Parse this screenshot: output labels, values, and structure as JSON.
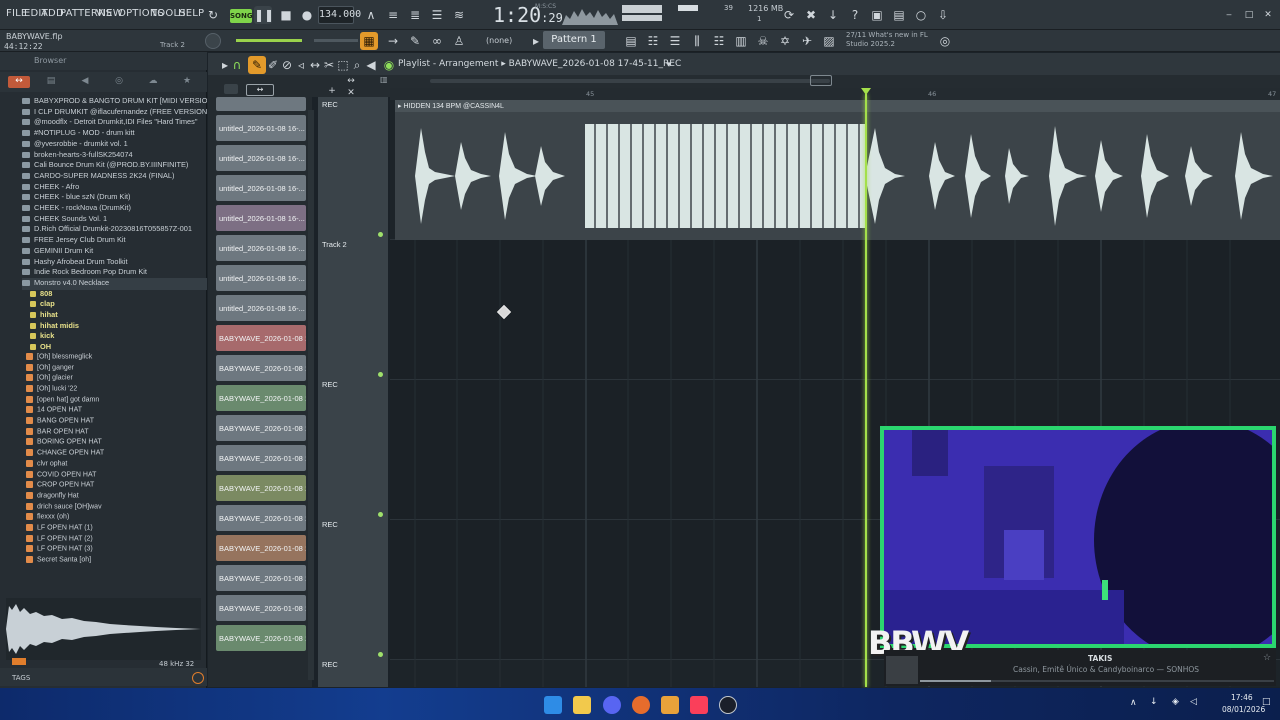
{
  "menu": [
    "FILE",
    "EDIT",
    "ADD",
    "PATTERNS",
    "VIEW",
    "OPTIONS",
    "TOOLS",
    "HELP"
  ],
  "transport": {
    "song_label": "SONG",
    "tempo": "134.000",
    "clock_main": "1:20",
    "clock_sub": ":29",
    "clock_unit": "M:S:CS",
    "cpu_value": "39",
    "cpu_poly": "1",
    "memory": "1216 MB"
  },
  "project": {
    "file": "BABYWAVE.flp",
    "time": "44:12:22",
    "hint_track": "Track 2"
  },
  "toolbar2": {
    "none_label": "(none)",
    "pattern": "Pattern 1",
    "whatsnew_line1": "27/11  What's new in FL",
    "whatsnew_line2": "Studio 2025.2"
  },
  "browser": {
    "header": "Browser",
    "items": [
      {
        "label": "BABYXPROD & BANGTO DRUM KIT [MIDI VERSION]",
        "type": "folder"
      },
      {
        "label": "I CLP DRUMKIT @iflacufernandez (FREE VERSION)",
        "type": "folder"
      },
      {
        "label": "@moodflx - Detroit Drumkit,IDI Files \"Hard Times\"",
        "type": "folder"
      },
      {
        "label": "#NOTIPLUG - MOD - drum kitt",
        "type": "folder"
      },
      {
        "label": "@yvesrobbie - drumkit vol. 1",
        "type": "folder"
      },
      {
        "label": "broken-hearts-3-fullSK254074",
        "type": "folder"
      },
      {
        "label": "Cali Bounce Drum Kit (@PROD.BY.IIINFINITE)",
        "type": "folder"
      },
      {
        "label": "CARDO-SUPER MADNESS 2K24 (FINAL)",
        "type": "folder"
      },
      {
        "label": "CHEEK - Afro",
        "type": "folder"
      },
      {
        "label": "CHEEK - blue szN (Drum Kit)",
        "type": "folder"
      },
      {
        "label": "CHEEK - rockNova (DrumKit)",
        "type": "folder"
      },
      {
        "label": "CHEEK Sounds Vol. 1",
        "type": "folder"
      },
      {
        "label": "D.Rich Official Drumkit-20230816T055857Z-001",
        "type": "folder"
      },
      {
        "label": "FREE Jersey Club Drum Kit",
        "type": "folder"
      },
      {
        "label": "GEMINII Drum Kit",
        "type": "folder"
      },
      {
        "label": "Hashy Afrobeat Drum Toolkit",
        "type": "folder"
      },
      {
        "label": "Indie Rock Bedroom Pop Drum Kit",
        "type": "folder"
      },
      {
        "label": "Monstro v4.0 Necklace",
        "type": "folder"
      },
      {
        "label": "808",
        "type": "sub"
      },
      {
        "label": "clap",
        "type": "sub"
      },
      {
        "label": "hihat",
        "type": "sub"
      },
      {
        "label": "hihat midis",
        "type": "sub"
      },
      {
        "label": "kick",
        "type": "sub"
      },
      {
        "label": "OH",
        "type": "sub"
      },
      {
        "label": "[Oh] blessmeglick",
        "type": "file"
      },
      {
        "label": "[Oh] ganger",
        "type": "file"
      },
      {
        "label": "[Oh] glacier",
        "type": "file"
      },
      {
        "label": "[Oh] lucki '22",
        "type": "file"
      },
      {
        "label": "[open hat] got damn",
        "type": "file"
      },
      {
        "label": "14 OPEN HAT",
        "type": "file"
      },
      {
        "label": "BANG OPEN HAT",
        "type": "file"
      },
      {
        "label": "BAR OPEN HAT",
        "type": "file"
      },
      {
        "label": "BORING OPEN HAT",
        "type": "file"
      },
      {
        "label": "CHANGE OPEN HAT",
        "type": "file"
      },
      {
        "label": "clvr ophat",
        "type": "file"
      },
      {
        "label": "COVID OPEN HAT",
        "type": "file"
      },
      {
        "label": "CROP OPEN HAT",
        "type": "file"
      },
      {
        "label": "dragonfly Hat",
        "type": "file"
      },
      {
        "label": "drich sauce [OH]wav",
        "type": "file"
      },
      {
        "label": "flexxx (oh)",
        "type": "file"
      },
      {
        "label": "LF OPEN HAT (1)",
        "type": "file"
      },
      {
        "label": "LF OPEN HAT (2)",
        "type": "file"
      },
      {
        "label": "LF OPEN HAT (3)",
        "type": "file"
      },
      {
        "label": "Secret Santa [oh]",
        "type": "file"
      }
    ],
    "preview_info": "48 kHz 32",
    "tags": "TAGS"
  },
  "playlist": {
    "title": "Playlist - Arrangement",
    "arrangement_name": "BABYWAVE_2026-01-08 17-45-11_REC",
    "bar_numbers": [
      "45",
      "46",
      "47"
    ],
    "clips": [
      {
        "label": "untitled_2026-01-08 16-...",
        "color": "#6e7880"
      },
      {
        "label": "untitled_2026-01-08 16-...",
        "color": "#6e7880"
      },
      {
        "label": "untitled_2026-01-08 16-...",
        "color": "#6e7880"
      },
      {
        "label": "untitled_2026-01-08 16-...",
        "color": "#7d6f84"
      },
      {
        "label": "untitled_2026-01-08 16-...",
        "color": "#6e7880"
      },
      {
        "label": "untitled_2026-01-08 16-...",
        "color": "#6e7880"
      },
      {
        "label": "untitled_2026-01-08 16-...",
        "color": "#6e7880"
      },
      {
        "label": "BABYWAVE_2026-01-08 1...",
        "color": "#a76a6c"
      },
      {
        "label": "BABYWAVE_2026-01-08 1...",
        "color": "#6e7880"
      },
      {
        "label": "BABYWAVE_2026-01-08 1...",
        "color": "#6a8a6e"
      },
      {
        "label": "BABYWAVE_2026-01-08 1...",
        "color": "#6e7880"
      },
      {
        "label": "BABYWAVE_2026-01-08 1...",
        "color": "#6e7880"
      },
      {
        "label": "BABYWAVE_2026-01-08 1...",
        "color": "#7b8a62"
      },
      {
        "label": "BABYWAVE_2026-01-08 1...",
        "color": "#6e7880"
      },
      {
        "label": "BABYWAVE_2026-01-08 1...",
        "color": "#96745e"
      },
      {
        "label": "BABYWAVE_2026-01-08 1...",
        "color": "#6e7880"
      },
      {
        "label": "BABYWAVE_2026-01-08 1...",
        "color": "#6e7880"
      },
      {
        "label": "BABYWAVE_2026-01-08 1...",
        "color": "#6a8a6e"
      }
    ],
    "tracks": [
      {
        "label": "REC"
      },
      {
        "label": "Track 2"
      },
      {
        "label": "REC"
      },
      {
        "label": "REC"
      },
      {
        "label": "REC"
      }
    ],
    "audio_clip_title": "HIDDEN 134 BPM @CASSIN4L"
  },
  "overlay": {
    "logo": "BBWV",
    "np_title": "TAKIS",
    "np_artist": "Cassin, Emitê Único & Candyboinarco — SONHOS",
    "np_progress": 0.2
  },
  "taskbar": {
    "time": "17:46",
    "date": "08/01/2026"
  },
  "colors": {
    "accent_green": "#a4e04a",
    "webcam_border": "#2bd66f",
    "taskbar": "#133d8f"
  }
}
